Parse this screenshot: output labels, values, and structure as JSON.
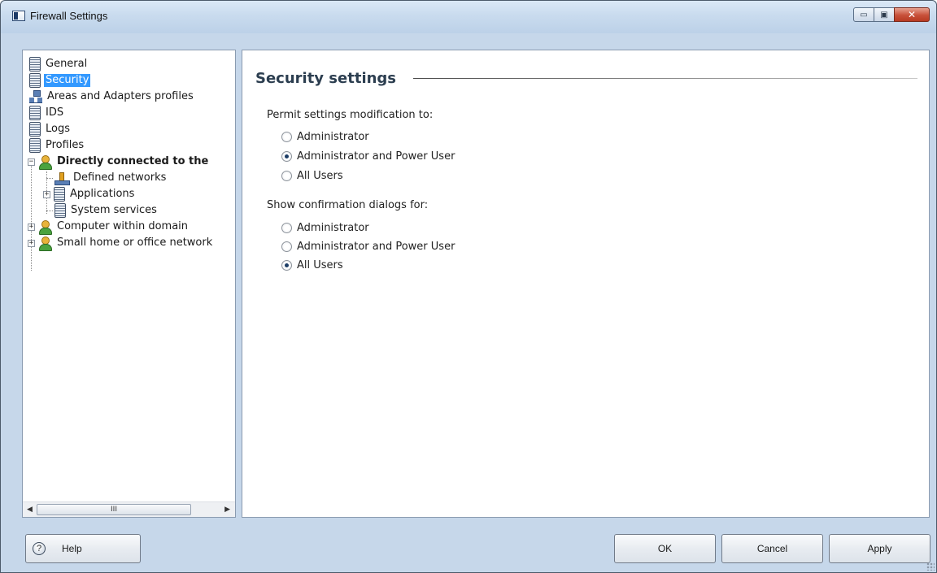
{
  "window": {
    "title": "Firewall Settings"
  },
  "window_controls": {
    "minimize": "▭",
    "maximize": "▣",
    "close": "✕"
  },
  "tree": {
    "items": [
      {
        "label": "General",
        "icon": "page-icon"
      },
      {
        "label": "Security",
        "icon": "page-icon",
        "selected": true
      },
      {
        "label": "Areas and Adapters profiles",
        "icon": "network-icon"
      },
      {
        "label": "IDS",
        "icon": "page-icon"
      },
      {
        "label": "Logs",
        "icon": "page-icon"
      },
      {
        "label": "Profiles",
        "icon": "page-icon"
      },
      {
        "label": "Directly connected to the",
        "icon": "user-icon",
        "expander": "−"
      },
      {
        "label": "Defined networks",
        "icon": "defined-network-icon"
      },
      {
        "label": "Applications",
        "icon": "page-icon",
        "expander": "+"
      },
      {
        "label": "System services",
        "icon": "page-icon"
      },
      {
        "label": "Computer within domain",
        "icon": "user-icon",
        "expander": "+"
      },
      {
        "label": "Small home or office network",
        "icon": "user-icon",
        "expander": "+"
      }
    ],
    "scrollbar": {
      "left_arrow": "◀",
      "thumb_grip": "III",
      "right_arrow": "▶"
    }
  },
  "content": {
    "heading": "Security settings",
    "permit_group": {
      "label": "Permit settings modification to:",
      "options": [
        "Administrator",
        "Administrator and Power User",
        "All Users"
      ],
      "selected": "Administrator and Power User"
    },
    "confirm_group": {
      "label": "Show confirmation dialogs for:",
      "options": [
        "Administrator",
        "Administrator and Power User",
        "All Users"
      ],
      "selected": "All Users"
    }
  },
  "footer": {
    "help_label": "Help",
    "help_glyph": "?",
    "ok_label": "OK",
    "cancel_label": "Cancel",
    "apply_label": "Apply"
  }
}
